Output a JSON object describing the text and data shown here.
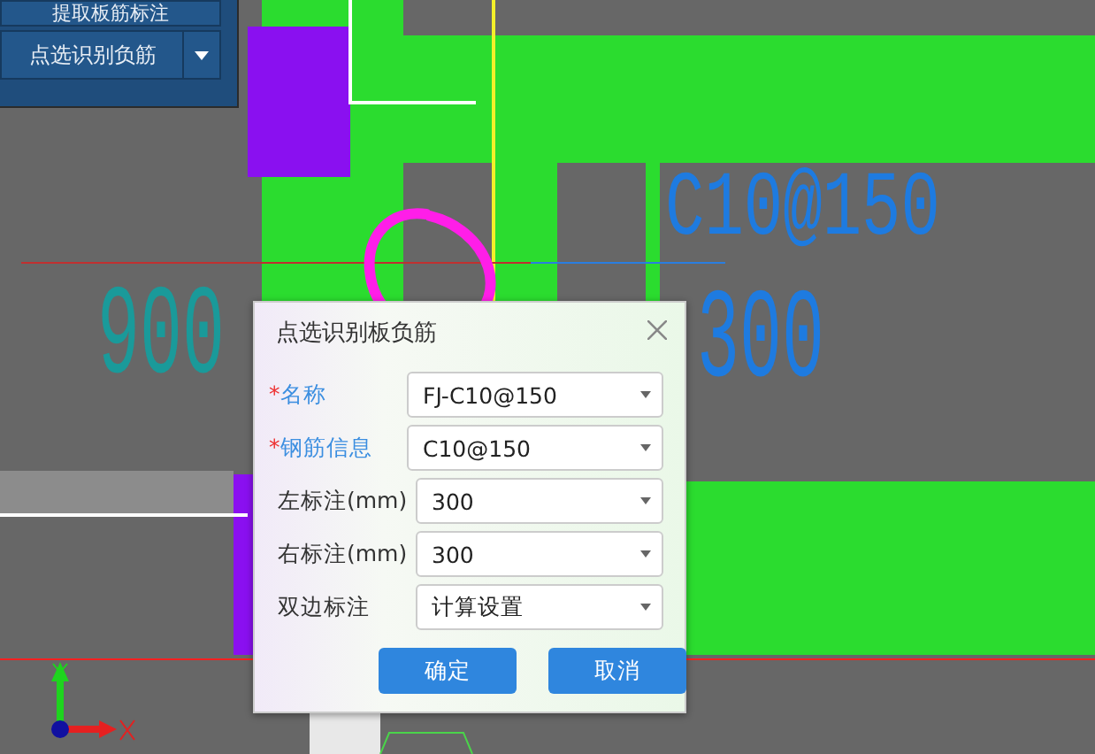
{
  "toolbar": {
    "buttons": [
      {
        "label": "提取板筋标注",
        "dropdown": false
      },
      {
        "label": "点选识别负筋",
        "dropdown": true
      }
    ]
  },
  "canvas": {
    "labels": [
      {
        "text": "C10@150",
        "color": "#1e7be0"
      },
      {
        "text": "900",
        "color": "#1a9a9a"
      },
      {
        "text": "300",
        "color": "#1e7be0"
      }
    ]
  },
  "dialog": {
    "title": "点选识别板负筋",
    "fields": [
      {
        "label": "名称",
        "required": true,
        "mark": "*",
        "value": "FJ-C10@150"
      },
      {
        "label": "钢筋信息",
        "required": true,
        "mark": "*",
        "value": "C10@150"
      },
      {
        "label": "左标注(mm)",
        "required": false,
        "value": "300"
      },
      {
        "label": "右标注(mm)",
        "required": false,
        "value": "300"
      },
      {
        "label": "双边标注",
        "required": false,
        "value": "计算设置"
      }
    ],
    "buttons": [
      "确定",
      "取消"
    ]
  }
}
